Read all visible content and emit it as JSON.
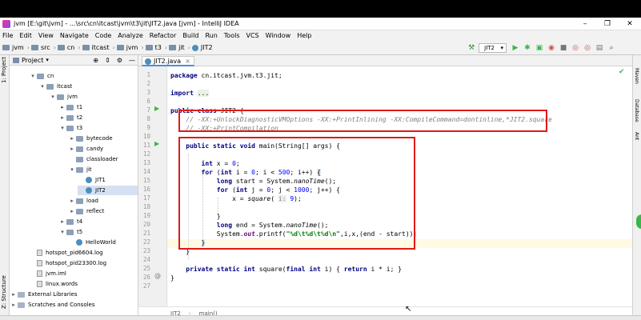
{
  "window": {
    "title": "jvm [E:\\git\\jvm] - ...\\src\\cn\\itcast\\jvm\\t3\\jit\\JIT2.java [jvm] - IntelliJ IDEA",
    "min": "–",
    "max": "❐",
    "close": "✕"
  },
  "menu": [
    "File",
    "Edit",
    "View",
    "Navigate",
    "Code",
    "Analyze",
    "Refactor",
    "Build",
    "Run",
    "Tools",
    "VCS",
    "Window",
    "Help"
  ],
  "breadcrumbs": [
    "jvm",
    "src",
    "cn",
    "itcast",
    "jvm",
    "t3",
    "jit",
    "JIT2"
  ],
  "toolbar": {
    "run_config": "JIT2"
  },
  "left_strip": {
    "project_tab": "1: Project",
    "structure_tab": "Z: Structure"
  },
  "right_strip": {
    "maven": "Maven",
    "database": "Database",
    "ant": "Ant"
  },
  "project_panel": {
    "title": "Project",
    "tree": [
      {
        "label": "cn",
        "arrow": "▾",
        "type": "folder"
      },
      {
        "label": "itcast",
        "arrow": "▾",
        "type": "folder"
      },
      {
        "label": "jvm",
        "arrow": "▾",
        "type": "folder"
      },
      {
        "label": "t1",
        "arrow": "▸",
        "type": "folder"
      },
      {
        "label": "t2",
        "arrow": "▸",
        "type": "folder"
      },
      {
        "label": "t3",
        "arrow": "▾",
        "type": "folder"
      },
      {
        "label": "bytecode",
        "arrow": "▸",
        "type": "folder"
      },
      {
        "label": "candy",
        "arrow": "▸",
        "type": "folder"
      },
      {
        "label": "classloader",
        "arrow": "",
        "type": "folder"
      },
      {
        "label": "jit",
        "arrow": "▾",
        "type": "folder"
      },
      {
        "label": "JIT1",
        "arrow": "",
        "type": "java"
      },
      {
        "label": "JIT2",
        "arrow": "",
        "type": "java"
      },
      {
        "label": "load",
        "arrow": "▸",
        "type": "folder"
      },
      {
        "label": "reflect",
        "arrow": "▸",
        "type": "folder"
      },
      {
        "label": "t4",
        "arrow": "▸",
        "type": "folder"
      },
      {
        "label": "t5",
        "arrow": "▾",
        "type": "folder"
      },
      {
        "label": "HelloWorld",
        "arrow": "",
        "type": "java"
      },
      {
        "label": "hotspot_pid6604.log",
        "arrow": "",
        "type": "file"
      },
      {
        "label": "hotspot_pid23300.log",
        "arrow": "",
        "type": "file"
      },
      {
        "label": "jvm.iml",
        "arrow": "",
        "type": "file"
      },
      {
        "label": "linux.words",
        "arrow": "",
        "type": "file"
      },
      {
        "label": "External Libraries",
        "arrow": "▸",
        "type": "folder"
      },
      {
        "label": "Scratches and Consoles",
        "arrow": "▸",
        "type": "folder"
      }
    ]
  },
  "editor": {
    "tab": "JIT2.java",
    "line_numbers": [
      "1",
      "2",
      "3",
      "6",
      "7",
      "8",
      "9",
      "10",
      "11",
      "12",
      "13",
      "14",
      "15",
      "16",
      "17",
      "18",
      "19",
      "20",
      "21",
      "22",
      "23",
      "24",
      "25",
      "26",
      "27"
    ],
    "lines": [
      "package cn.itcast.jvm.t3.jit;",
      "",
      "import ...",
      "",
      "public class JIT2 {",
      "    // -XX:+UnlockDiagnosticVMOptions -XX:+PrintInlining -XX:CompileCommand=dontinline,*JIT2.square",
      "    // -XX:+PrintCompilation",
      "",
      "    public static void main(String[] args) {",
      "",
      "        int x = 0;",
      "        for (int i = 0; i < 500; i++) {",
      "            long start = System.nanoTime();",
      "            for (int j = 0; j < 1000; j++) {",
      "                x = square( i: 9);",
      "",
      "            }",
      "            long end = System.nanoTime();",
      "            System.out.printf(\"%d\\t%d\\t%d\\n\",i,x,(end - start));",
      "        }",
      "    }",
      "",
      "    private static int square(final int i) { return i * i; }",
      "}",
      ""
    ],
    "breadcrumb": [
      "JIT2",
      "main()"
    ]
  }
}
